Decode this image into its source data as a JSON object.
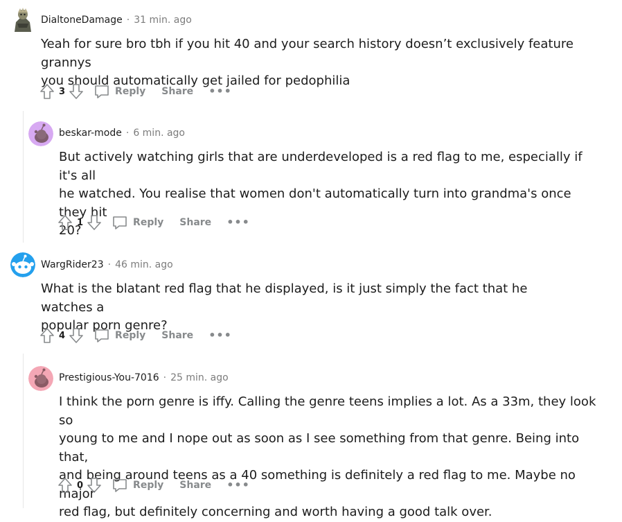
{
  "comments": [
    {
      "username": "DialtoneDamage",
      "separator": "·",
      "time": "31 min. ago",
      "lines": [
        "Yeah for sure bro tbh if you hit 40 and your search history doesn’t exclusively feature grannys",
        "you should automatically get jailed for pedophilia"
      ],
      "score": "3",
      "reply_label": "Reply",
      "share_label": "Share",
      "more_label": "•••"
    },
    {
      "username": "beskar-mode",
      "separator": "·",
      "time": "6 min. ago",
      "lines": [
        "But actively watching girls that are underdeveloped is a red flag to me, especially if it's all",
        "he watched. You realise that women don't automatically turn into grandma's once they hit",
        "20?"
      ],
      "score": "1",
      "reply_label": "Reply",
      "share_label": "Share",
      "more_label": "•••"
    },
    {
      "username": "WargRider23",
      "separator": "·",
      "time": "46 min. ago",
      "lines": [
        "What is the blatant red flag that he displayed, is it just simply the fact that he watches a",
        "popular porn genre?"
      ],
      "score": "4",
      "reply_label": "Reply",
      "share_label": "Share",
      "more_label": "•••"
    },
    {
      "username": "Prestigious-You-7016",
      "separator": "·",
      "time": "25 min. ago",
      "lines": [
        "I think the porn genre is iffy. Calling the genre teens implies a lot. As a 33m, they look so",
        "young to me and I nope out as soon as I see something from that genre. Being into that,",
        "and being around teens as a 40 something is definitely a red flag to me. Maybe no major",
        "red flag, but definitely concerning and worth having a good talk over."
      ],
      "score": "0",
      "reply_label": "Reply",
      "share_label": "Share",
      "more_label": "•••"
    }
  ],
  "colors": {
    "avatar_purple": "#d7a9f2",
    "avatar_blue": "#24a0ed",
    "avatar_pink": "#f4a7b5",
    "meta_gray": "#7c7c7c",
    "thread_line": "#e6e6e6"
  }
}
